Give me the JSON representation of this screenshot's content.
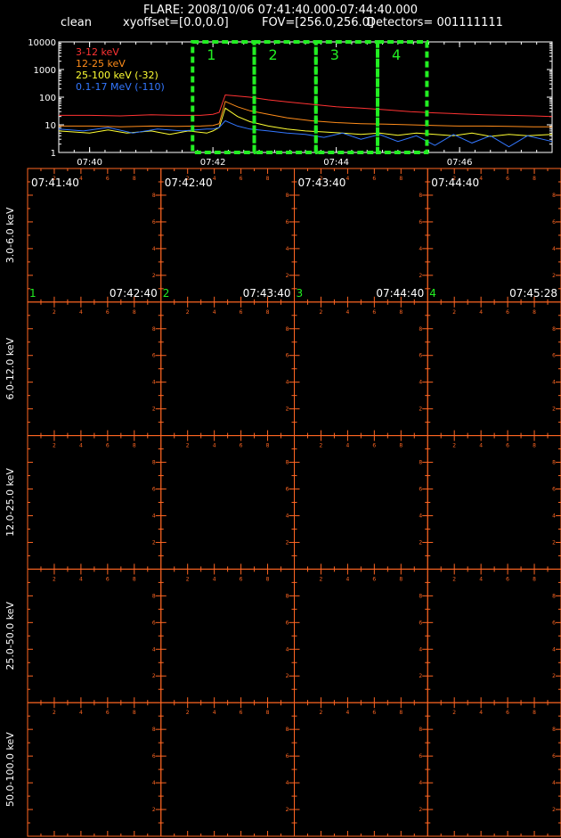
{
  "header": {
    "title": "FLARE: 2008/10/06 07:41:40.000-07:44:40.000",
    "mode": "clean",
    "xyoffset": "xyoffset=[0.0,0.0]",
    "fov": "FOV=[256.0,256.0]",
    "detectors": "Detectors= 001111111"
  },
  "colors": {
    "background": "#000000",
    "grid": "#ff6622",
    "interval_box": "#22ee22",
    "text": "#ffffff",
    "panel_index": "#22ee22"
  },
  "chart_data": [
    {
      "type": "line",
      "title": "",
      "xlabel": "",
      "ylabel": "",
      "x_ticks": [
        "07:40",
        "07:42",
        "07:44",
        "07:46"
      ],
      "x_tick_minutes": [
        40,
        42,
        44,
        46
      ],
      "xlim_minutes": [
        39.5,
        47.5
      ],
      "y_scale": "log",
      "ylim": [
        1,
        10000
      ],
      "y_ticks": [
        "1",
        "10",
        "100",
        "1000",
        "10000"
      ],
      "legend_position": "top-left",
      "intervals": [
        {
          "label": "1",
          "start_minutes": 41.67,
          "end_minutes": 42.67
        },
        {
          "label": "2",
          "start_minutes": 42.67,
          "end_minutes": 43.67
        },
        {
          "label": "3",
          "start_minutes": 43.67,
          "end_minutes": 44.67
        },
        {
          "label": "4",
          "start_minutes": 44.67,
          "end_minutes": 45.47
        }
      ],
      "series": [
        {
          "name": "3-12 keV",
          "color": "#ff3333",
          "x": [
            39.5,
            40.0,
            40.5,
            41.0,
            41.4,
            41.8,
            42.0,
            42.1,
            42.2,
            42.4,
            42.6,
            42.9,
            43.2,
            43.6,
            44.0,
            44.4,
            44.8,
            45.2,
            45.6,
            46.0,
            46.4,
            46.8,
            47.2,
            47.5
          ],
          "y": [
            22,
            22,
            21,
            23,
            22,
            22,
            24,
            28,
            120,
            110,
            100,
            80,
            68,
            55,
            45,
            40,
            35,
            30,
            27,
            25,
            23,
            22,
            21,
            20
          ]
        },
        {
          "name": "12-25 keV",
          "color": "#ff8c1a",
          "x": [
            39.5,
            40.0,
            40.5,
            41.0,
            41.4,
            41.8,
            42.0,
            42.1,
            42.2,
            42.4,
            42.6,
            42.9,
            43.2,
            43.6,
            44.0,
            44.4,
            44.8,
            45.2,
            45.6,
            46.0,
            46.4,
            46.8,
            47.2,
            47.5
          ],
          "y": [
            9,
            9,
            8.5,
            9,
            8.8,
            9,
            9.5,
            11,
            70,
            45,
            32,
            24,
            18,
            14,
            12,
            11,
            10.5,
            10,
            9.5,
            9,
            9,
            8.8,
            8.5,
            8.5
          ]
        },
        {
          "name": "25-100 keV (-32)",
          "color": "#ffff33",
          "x": [
            39.5,
            40.0,
            40.3,
            40.6,
            41.0,
            41.3,
            41.6,
            41.9,
            42.0,
            42.1,
            42.2,
            42.4,
            42.6,
            42.9,
            43.2,
            43.5,
            43.8,
            44.1,
            44.4,
            44.7,
            45.0,
            45.3,
            45.6,
            45.9,
            46.2,
            46.5,
            46.8,
            47.1,
            47.5
          ],
          "y": [
            6,
            5,
            6.5,
            5,
            6,
            4.5,
            6,
            5,
            6,
            8,
            40,
            20,
            13,
            9,
            7,
            6,
            5.5,
            5,
            4.5,
            5,
            4.2,
            5,
            4.5,
            4,
            5,
            3.8,
            4.5,
            4,
            4.5
          ]
        },
        {
          "name": "0.1-17 MeV (-110)",
          "color": "#3377ff",
          "x": [
            39.5,
            39.9,
            40.3,
            40.7,
            41.1,
            41.5,
            41.9,
            42.0,
            42.1,
            42.2,
            42.4,
            42.6,
            42.9,
            43.2,
            43.5,
            43.8,
            44.1,
            44.4,
            44.7,
            45.0,
            45.3,
            45.6,
            45.9,
            46.2,
            46.5,
            46.8,
            47.1,
            47.5
          ],
          "y": [
            7,
            6,
            8,
            5,
            7,
            6,
            7,
            7,
            8,
            14,
            9,
            7,
            6,
            5,
            4.5,
            3.5,
            5,
            3,
            4.5,
            2.5,
            4,
            1.8,
            4.5,
            2.2,
            4,
            1.6,
            4,
            2.5
          ]
        }
      ]
    },
    {
      "type": "heatmap",
      "title": "",
      "row_labels": [
        "3.0-6.0 keV",
        "6.0-12.0 keV",
        "12.0-25.0 keV",
        "25.0-50.0 keV",
        "50.0-100.0 keV"
      ],
      "col_start_times": [
        "07:41:40",
        "07:42:40",
        "07:43:40",
        "07:44:40"
      ],
      "col_end_times": [
        "07:42:40",
        "07:43:40",
        "07:44:40",
        "07:45:28"
      ],
      "col_indices": [
        "1",
        "2",
        "3",
        "4"
      ],
      "tick_labels": [
        "2",
        "4",
        "6",
        "8"
      ],
      "values": "empty"
    }
  ]
}
